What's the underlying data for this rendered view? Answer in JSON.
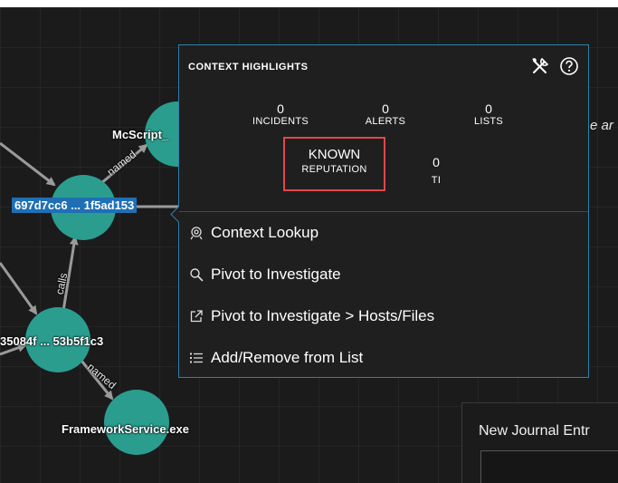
{
  "graph": {
    "nodes": {
      "mcscript": "McScript_",
      "hash1": "697d7cc6 ... 1f5ad153",
      "hash2": "35084f ... 53b5f1c3",
      "framework": "FrameworkService.exe"
    },
    "edges": {
      "named1": "named",
      "calls": "calls",
      "named2": "named"
    },
    "node_color": "#2a9d8f"
  },
  "side_text": "e ar",
  "journal": {
    "title": "New Journal Entr"
  },
  "context": {
    "title": "CONTEXT HIGHLIGHTS",
    "tools_icon": "tools-icon",
    "help_icon": "help-circle-icon",
    "stats": {
      "incidents": {
        "value": "0",
        "label": "INCIDENTS"
      },
      "alerts": {
        "value": "0",
        "label": "ALERTS"
      },
      "lists": {
        "value": "0",
        "label": "LISTS"
      },
      "reputation": {
        "value": "KNOWN",
        "label": "REPUTATION"
      },
      "ti": {
        "value": "0",
        "label": "TI"
      }
    },
    "highlight_color": "#e0474a",
    "border_color": "#2e7fa8",
    "menu": [
      {
        "label": "Context Lookup",
        "icon": "context-lookup-icon"
      },
      {
        "label": "Pivot to Investigate",
        "icon": "search-icon"
      },
      {
        "label": "Pivot to Investigate > Hosts/Files",
        "icon": "external-link-icon"
      },
      {
        "label": "Add/Remove from List",
        "icon": "list-icon"
      }
    ]
  }
}
